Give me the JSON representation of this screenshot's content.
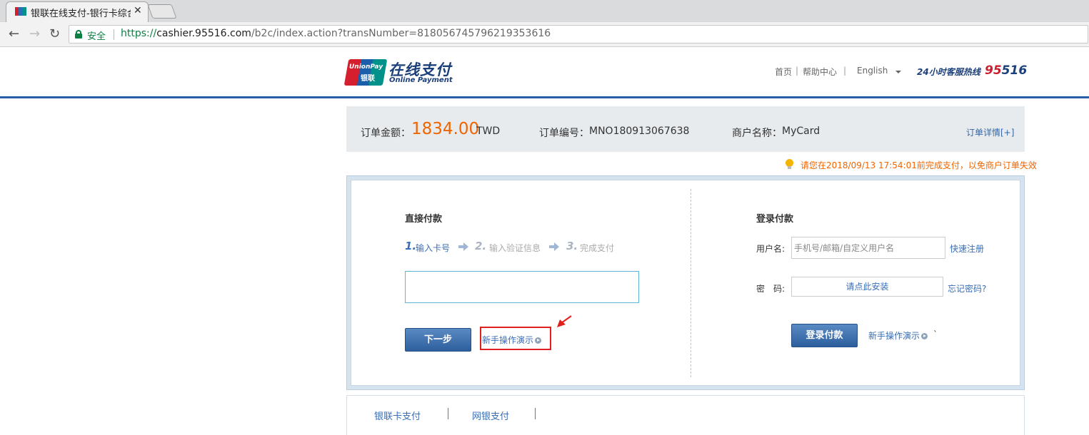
{
  "browser": {
    "tab_title": "银联在线支付-银行卡综合",
    "tab_close": "✕",
    "secure_label": "安全",
    "url_protocol": "https://",
    "url_host": "cashier.95516.com",
    "url_path": "/b2c/index.action?transNumber=818056745796219353616"
  },
  "header": {
    "logo_badge_top": "UnionPay",
    "logo_badge_bottom": "银联",
    "logo_cn": "在线支付",
    "logo_en": "Online Payment",
    "links": {
      "home": "首页",
      "help": "帮助中心",
      "language": "English"
    },
    "separator": "|",
    "hotline_label": "24小时客服热线",
    "hotline_prefix": "95",
    "hotline_suffix": "516"
  },
  "order": {
    "amount_label": "订单金额：",
    "amount": "1834.00",
    "currency": "TWD",
    "number_label": "订单编号：",
    "number": "MNO180913067638",
    "merchant_label": "商户名称：",
    "merchant": "MyCard",
    "detail_link": "订单详情[+]"
  },
  "notice": "请您在2018/09/13 17:54:01前完成支付，以免商户订单失效",
  "direct_pay": {
    "title": "直接付款",
    "steps": [
      {
        "num": "1.",
        "label": "输入卡号"
      },
      {
        "num": "2.",
        "label": "输入验证信息"
      },
      {
        "num": "3.",
        "label": "完成支付"
      }
    ],
    "card_input_value": "",
    "next_button": "下一步",
    "demo_link": "新手操作演示"
  },
  "login_pay": {
    "title": "登录付款",
    "username_label": "用户名:",
    "username_placeholder": "手机号/邮箱/自定义用户名",
    "register_link": "快速注册",
    "password_label": "密　码:",
    "password_install": "请点此安装",
    "forgot_link": "忘记密码?",
    "login_button": "登录付款",
    "demo_link": "新手操作演示",
    "stray_mark": "`"
  },
  "bottom_tabs": [
    "银联卡支付",
    "网银支付"
  ],
  "colors": {
    "accent_blue": "#2a5ba6",
    "amount_orange": "#f06400",
    "highlight_red": "#e0201e"
  }
}
